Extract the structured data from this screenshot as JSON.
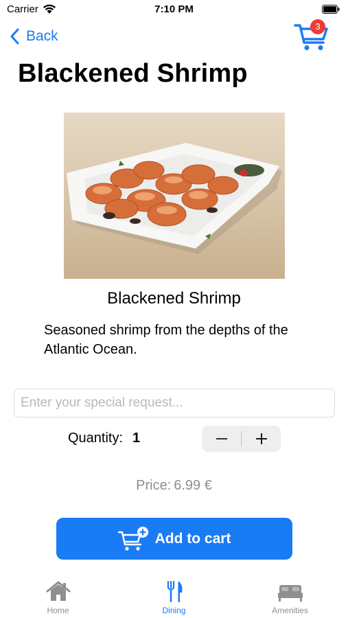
{
  "status_bar": {
    "carrier": "Carrier",
    "time": "7:10 PM"
  },
  "nav": {
    "back_label": "Back",
    "cart_count": "3"
  },
  "page_title": "Blackened Shrimp",
  "item": {
    "photo_alt": "plate of blackened shrimp",
    "name": "Blackened Shrimp",
    "description": "Seasoned shrimp from the depths of the Atlantic Ocean."
  },
  "request": {
    "placeholder": "Enter your special request...",
    "value": ""
  },
  "quantity": {
    "label": "Quantity:",
    "value": "1"
  },
  "price": {
    "label": "Price:",
    "value": "6.99 €"
  },
  "add_to_cart": {
    "label": "Add to cart"
  },
  "tabs": [
    {
      "label": "Home",
      "icon": "home-icon",
      "active": false
    },
    {
      "label": "Dining",
      "icon": "fork-knife-icon",
      "active": true
    },
    {
      "label": "Amenities",
      "icon": "bed-icon",
      "active": false
    }
  ],
  "colors": {
    "accent": "#1a7cf5",
    "badge": "#ef3b36",
    "inactive": "#8e8e93",
    "stepper_bg": "#eeeeef"
  }
}
